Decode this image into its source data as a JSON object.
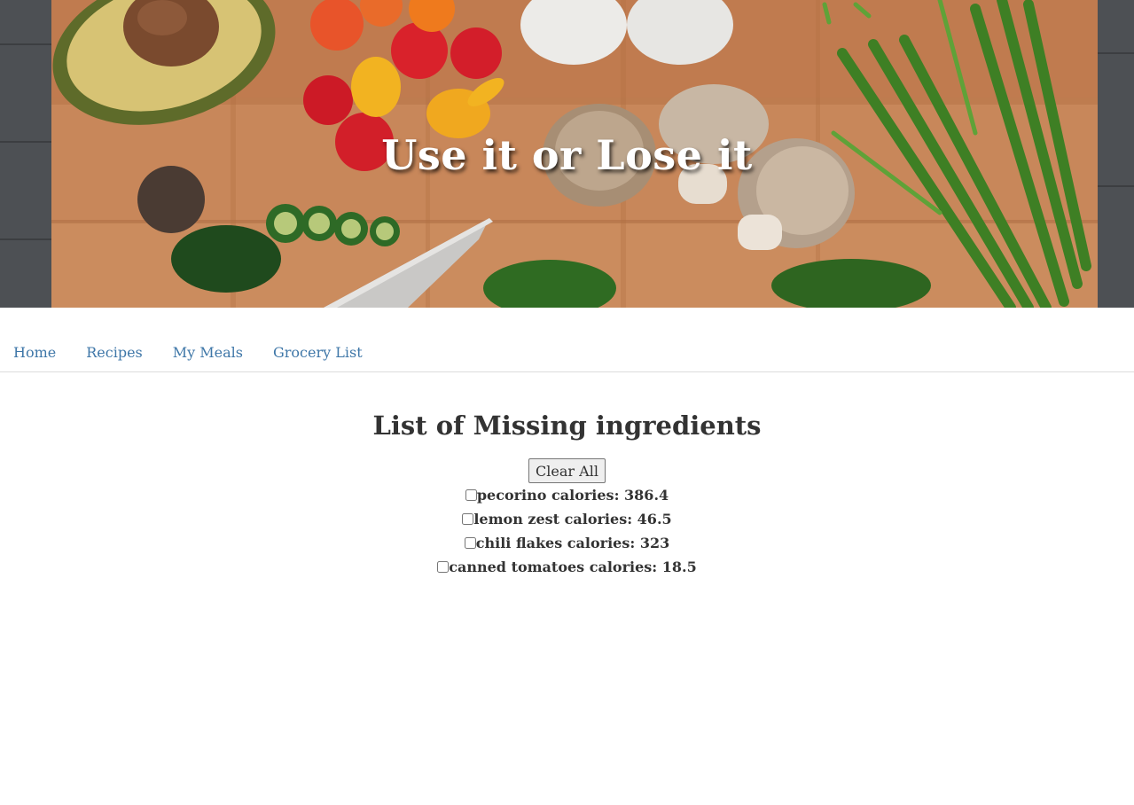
{
  "hero": {
    "title": "Use it or Lose it"
  },
  "nav": {
    "items": [
      {
        "label": "Home"
      },
      {
        "label": "Recipes"
      },
      {
        "label": "My Meals"
      },
      {
        "label": "Grocery List"
      }
    ]
  },
  "main": {
    "heading": "List of Missing ingredients",
    "clear_label": "Clear All",
    "ingredients": [
      {
        "label": "pecorino calories: 386.4",
        "checked": false
      },
      {
        "label": "lemon zest calories: 46.5",
        "checked": false
      },
      {
        "label": "chili flakes calories: 323",
        "checked": false
      },
      {
        "label": "canned tomatoes calories: 18.5",
        "checked": false
      }
    ]
  },
  "colors": {
    "link": "#3f77a8",
    "text": "#333333",
    "hero_title": "#ffffff"
  }
}
